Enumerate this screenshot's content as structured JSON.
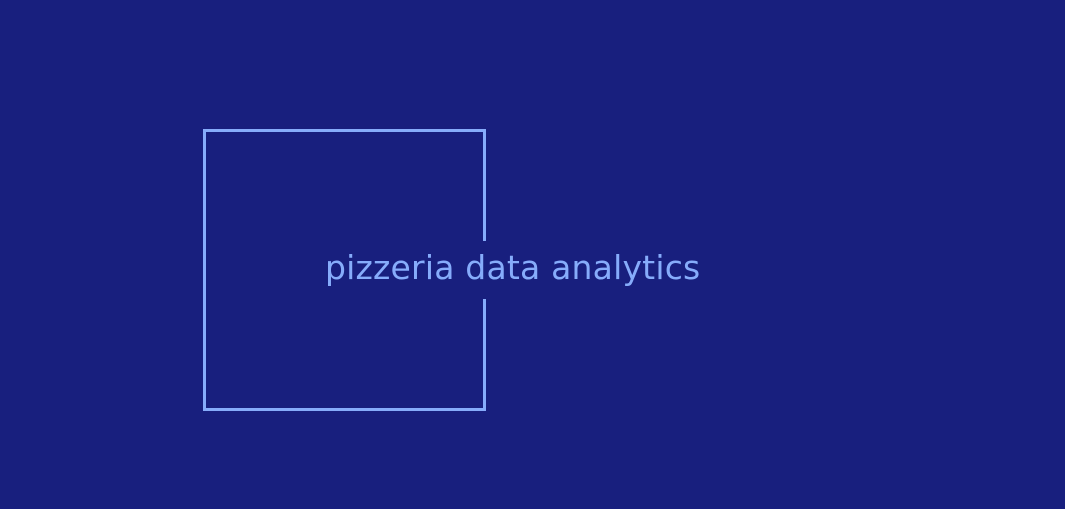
{
  "brand": {
    "title": "pizzeria data analytics"
  },
  "colors": {
    "background": "#181f7e",
    "accent": "#86acfb"
  }
}
